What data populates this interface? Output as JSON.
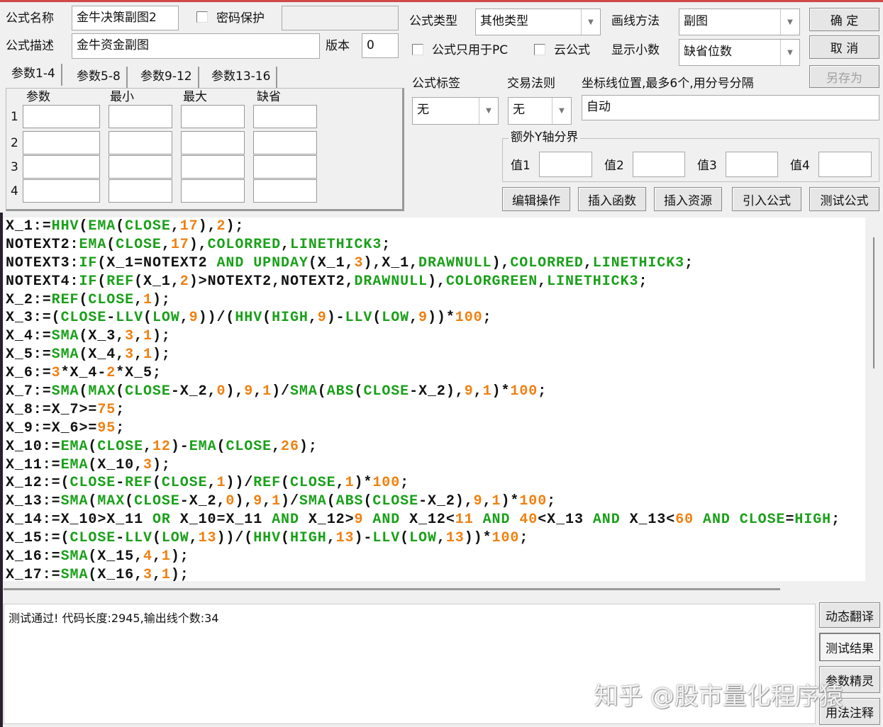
{
  "form": {
    "name_label": "公式名称",
    "name_value": "金牛决策副图2",
    "password_label": "密码保护",
    "password_checked": false,
    "desc_label": "公式描述",
    "desc_value": "金牛资金副图",
    "version_label": "版本",
    "version_value": "0",
    "type_label": "公式类型",
    "type_value": "其他类型",
    "draw_label": "画线方法",
    "draw_value": "副图",
    "pc_only_label": "公式只用于PC",
    "cloud_label": "云公式",
    "decimals_label": "显示小数",
    "decimals_value": "缺省位数",
    "tag_label": "公式标签",
    "tag_value": "无",
    "trade_label": "交易法则",
    "trade_value": "无",
    "axis_label": "坐标线位置,最多6个,用分号分隔",
    "axis_value": "自动",
    "yaxis_group": "额外Y轴分界",
    "yvals": [
      "值1",
      "值2",
      "值3",
      "值4"
    ]
  },
  "buttons": {
    "ok": "确  定",
    "cancel": "取  消",
    "save_as": "另存为",
    "edit": "编辑操作",
    "insert_func": "插入函数",
    "insert_res": "插入资源",
    "import": "引入公式",
    "test": "测试公式",
    "translate": "动态翻译",
    "test_result": "测试结果",
    "param_wizard": "参数精灵",
    "usage": "用法注释"
  },
  "params": {
    "tabs": [
      "参数1-4",
      "参数5-8",
      "参数9-12",
      "参数13-16"
    ],
    "headers": [
      "参数",
      "最小",
      "最大",
      "缺省"
    ],
    "rows": [
      "1",
      "2",
      "3",
      "4"
    ]
  },
  "code_lines": [
    "X_1:=HHV(EMA(CLOSE,17),2);",
    "NOTEXT2:EMA(CLOSE,17),COLORRED,LINETHICK3;",
    "NOTEXT3:IF(X_1=NOTEXT2 AND UPNDAY(X_1,3),X_1,DRAWNULL),COLORRED,LINETHICK3;",
    "NOTEXT4:IF(REF(X_1,2)>NOTEXT2,NOTEXT2,DRAWNULL),COLORGREEN,LINETHICK3;",
    "X_2:=REF(CLOSE,1);",
    "X_3:=(CLOSE-LLV(LOW,9))/(HHV(HIGH,9)-LLV(LOW,9))*100;",
    "X_4:=SMA(X_3,3,1);",
    "X_5:=SMA(X_4,3,1);",
    "X_6:=3*X_4-2*X_5;",
    "X_7:=SMA(MAX(CLOSE-X_2,0),9,1)/SMA(ABS(CLOSE-X_2),9,1)*100;",
    "X_8:=X_7>=75;",
    "X_9:=X_6>=95;",
    "X_10:=EMA(CLOSE,12)-EMA(CLOSE,26);",
    "X_11:=EMA(X_10,3);",
    "X_12:=(CLOSE-REF(CLOSE,1))/REF(CLOSE,1)*100;",
    "X_13:=SMA(MAX(CLOSE-X_2,0),9,1)/SMA(ABS(CLOSE-X_2),9,1)*100;",
    "X_14:=X_10>X_11 OR X_10=X_11 AND X_12>9 AND X_12<11 AND 40<X_13 AND X_13<60 AND CLOSE=HIGH;",
    "X_15:=(CLOSE-LLV(LOW,13))/(HHV(HIGH,13)-LLV(LOW,13))*100;",
    "X_16:=SMA(X_15,4,1);",
    "X_17:=SMA(X_16,3,1);"
  ],
  "output_text": "测试通过! 代码长度:2945,输出线个数:34",
  "watermark": "知乎 @股市量化程序猿",
  "colors": {
    "keyword": "#1aa01a",
    "number": "#f08010",
    "accent_line": "#d04848"
  }
}
